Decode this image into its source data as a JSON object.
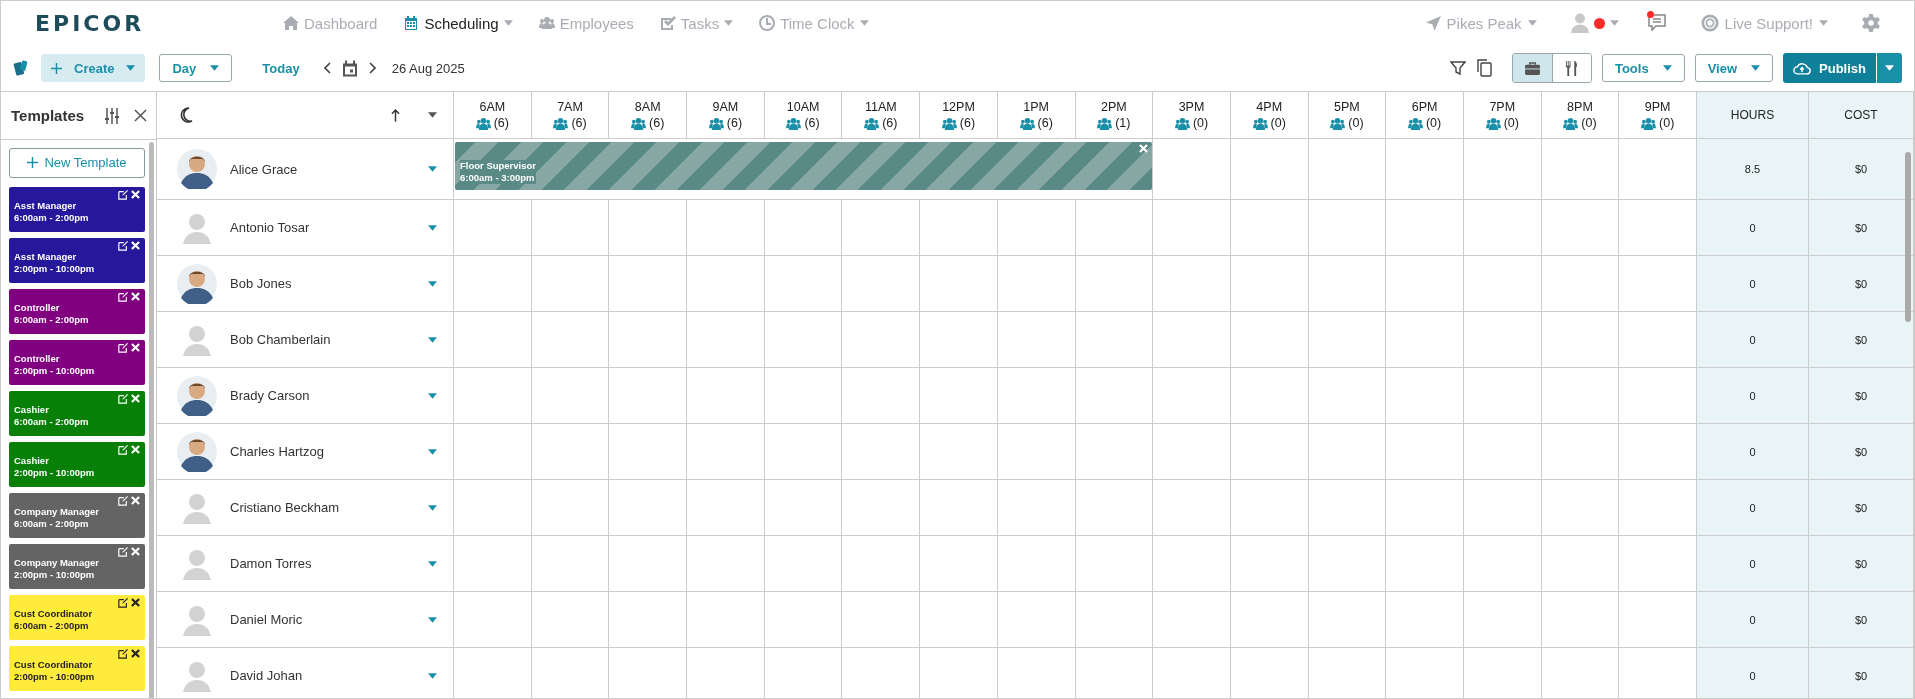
{
  "logo": "EPICOR",
  "nav": [
    {
      "label": "Dashboard",
      "selected": false,
      "menu": false
    },
    {
      "label": "Scheduling",
      "selected": true,
      "menu": true
    },
    {
      "label": "Employees",
      "selected": false,
      "menu": false
    },
    {
      "label": "Tasks",
      "selected": false,
      "menu": true
    },
    {
      "label": "Time Clock",
      "selected": false,
      "menu": true
    }
  ],
  "location": "Pikes Peak",
  "support": "Live Support!",
  "toolbar": {
    "create": "Create",
    "view_mode": "Day",
    "today": "Today",
    "date": "26 Aug 2025",
    "toggle": [
      {
        "selected": true
      },
      {
        "selected": false
      }
    ],
    "tools": "Tools",
    "view": "View",
    "publish": "Publish"
  },
  "templates_panel": {
    "title": "Templates",
    "new_button": "New Template",
    "items": [
      {
        "role": "Asst Manager",
        "time": "6:00am - 2:00pm",
        "color": "#25189a"
      },
      {
        "role": "Asst Manager",
        "time": "2:00pm - 10:00pm",
        "color": "#25189a"
      },
      {
        "role": "Controller",
        "time": "6:00am - 2:00pm",
        "color": "#800080"
      },
      {
        "role": "Controller",
        "time": "2:00pm - 10:00pm",
        "color": "#800080"
      },
      {
        "role": "Cashier",
        "time": "6:00am - 2:00pm",
        "color": "#088008"
      },
      {
        "role": "Cashier",
        "time": "2:00pm - 10:00pm",
        "color": "#088008"
      },
      {
        "role": "Company Manager",
        "time": "6:00am - 2:00pm",
        "color": "#646464"
      },
      {
        "role": "Company Manager",
        "time": "2:00pm - 10:00pm",
        "color": "#646464"
      },
      {
        "role": "Cust Coordinator",
        "time": "6:00am - 2:00pm",
        "color": "#ffeb3b"
      },
      {
        "role": "Cust Coordinator",
        "time": "2:00pm - 10:00pm",
        "color": "#ffeb3b"
      }
    ]
  },
  "hours": [
    {
      "label": "6AM",
      "count": "(6)"
    },
    {
      "label": "7AM",
      "count": "(6)"
    },
    {
      "label": "8AM",
      "count": "(6)"
    },
    {
      "label": "9AM",
      "count": "(6)"
    },
    {
      "label": "10AM",
      "count": "(6)"
    },
    {
      "label": "11AM",
      "count": "(6)"
    },
    {
      "label": "12PM",
      "count": "(6)"
    },
    {
      "label": "1PM",
      "count": "(6)"
    },
    {
      "label": "2PM",
      "count": "(1)"
    },
    {
      "label": "3PM",
      "count": "(0)"
    },
    {
      "label": "4PM",
      "count": "(0)"
    },
    {
      "label": "5PM",
      "count": "(0)"
    },
    {
      "label": "6PM",
      "count": "(0)"
    },
    {
      "label": "7PM",
      "count": "(0)"
    },
    {
      "label": "8PM",
      "count": "(0)"
    },
    {
      "label": "9PM",
      "count": "(0)"
    }
  ],
  "summary_columns": [
    "HOURS",
    "COST"
  ],
  "employees": [
    {
      "name": "Alice Grace",
      "kind": "photo",
      "hours": "8.5",
      "cost": "$0",
      "shift": {
        "role": "Floor Supervisor",
        "time": "6:00am - 3:00pm"
      }
    },
    {
      "name": "Antonio Tosar",
      "kind": "placeholder",
      "hours": "0",
      "cost": "$0"
    },
    {
      "name": "Bob Jones",
      "kind": "photo",
      "hours": "0",
      "cost": "$0"
    },
    {
      "name": "Bob Chamberlain",
      "kind": "placeholder",
      "hours": "0",
      "cost": "$0"
    },
    {
      "name": "Brady Carson",
      "kind": "photo",
      "hours": "0",
      "cost": "$0"
    },
    {
      "name": "Charles Hartzog",
      "kind": "photo",
      "hours": "0",
      "cost": "$0"
    },
    {
      "name": "Cristiano Beckham",
      "kind": "placeholder",
      "hours": "0",
      "cost": "$0"
    },
    {
      "name": "Damon Torres",
      "kind": "placeholder",
      "hours": "0",
      "cost": "$0"
    },
    {
      "name": "Daniel Moric",
      "kind": "placeholder",
      "hours": "0",
      "cost": "$0"
    },
    {
      "name": "David Johan",
      "kind": "placeholder",
      "hours": "0",
      "cost": "$0"
    }
  ]
}
